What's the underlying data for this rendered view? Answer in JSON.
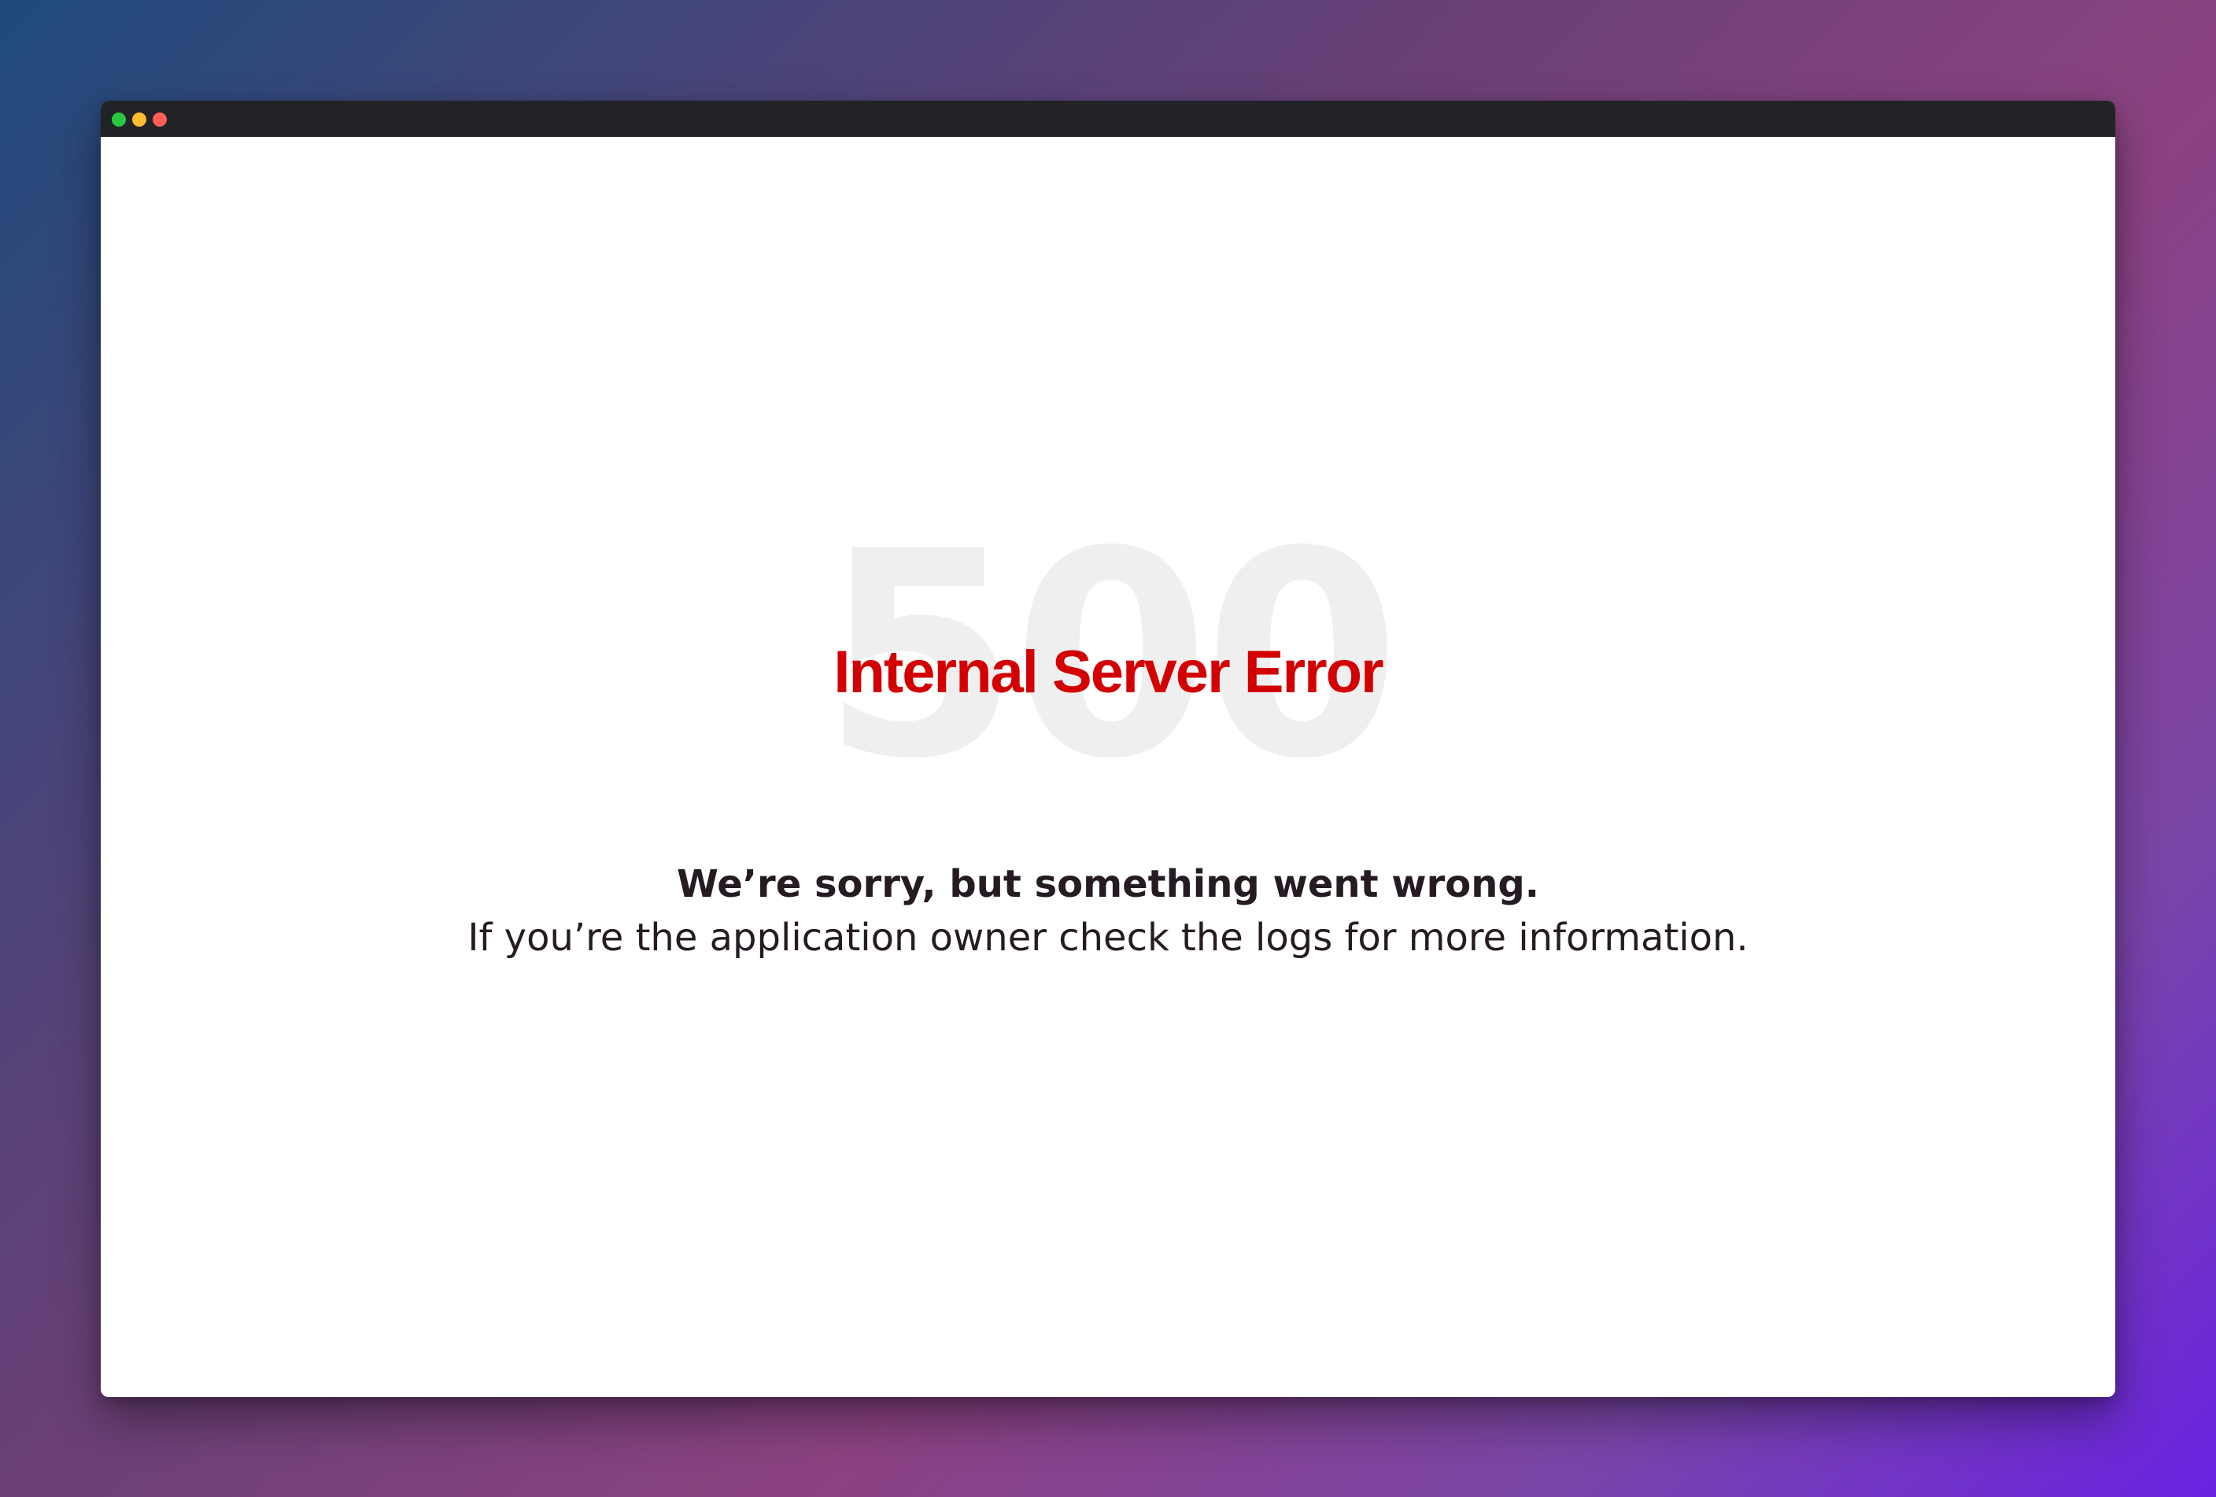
{
  "window": {
    "controls": [
      {
        "name": "green-dot",
        "color": "#28c840"
      },
      {
        "name": "yellow-dot",
        "color": "#febc2e"
      },
      {
        "name": "red-dot",
        "color": "#ff5f57"
      }
    ]
  },
  "error": {
    "code": "500",
    "title": "Internal Server Error",
    "message": "We’re sorry, but something went wrong.",
    "detail": "If you’re the application owner check the logs for more information."
  },
  "colors": {
    "title_red": "#d30001",
    "code_gray": "#efefef",
    "text_dark": "#261b23",
    "titlebar": "#222326"
  }
}
